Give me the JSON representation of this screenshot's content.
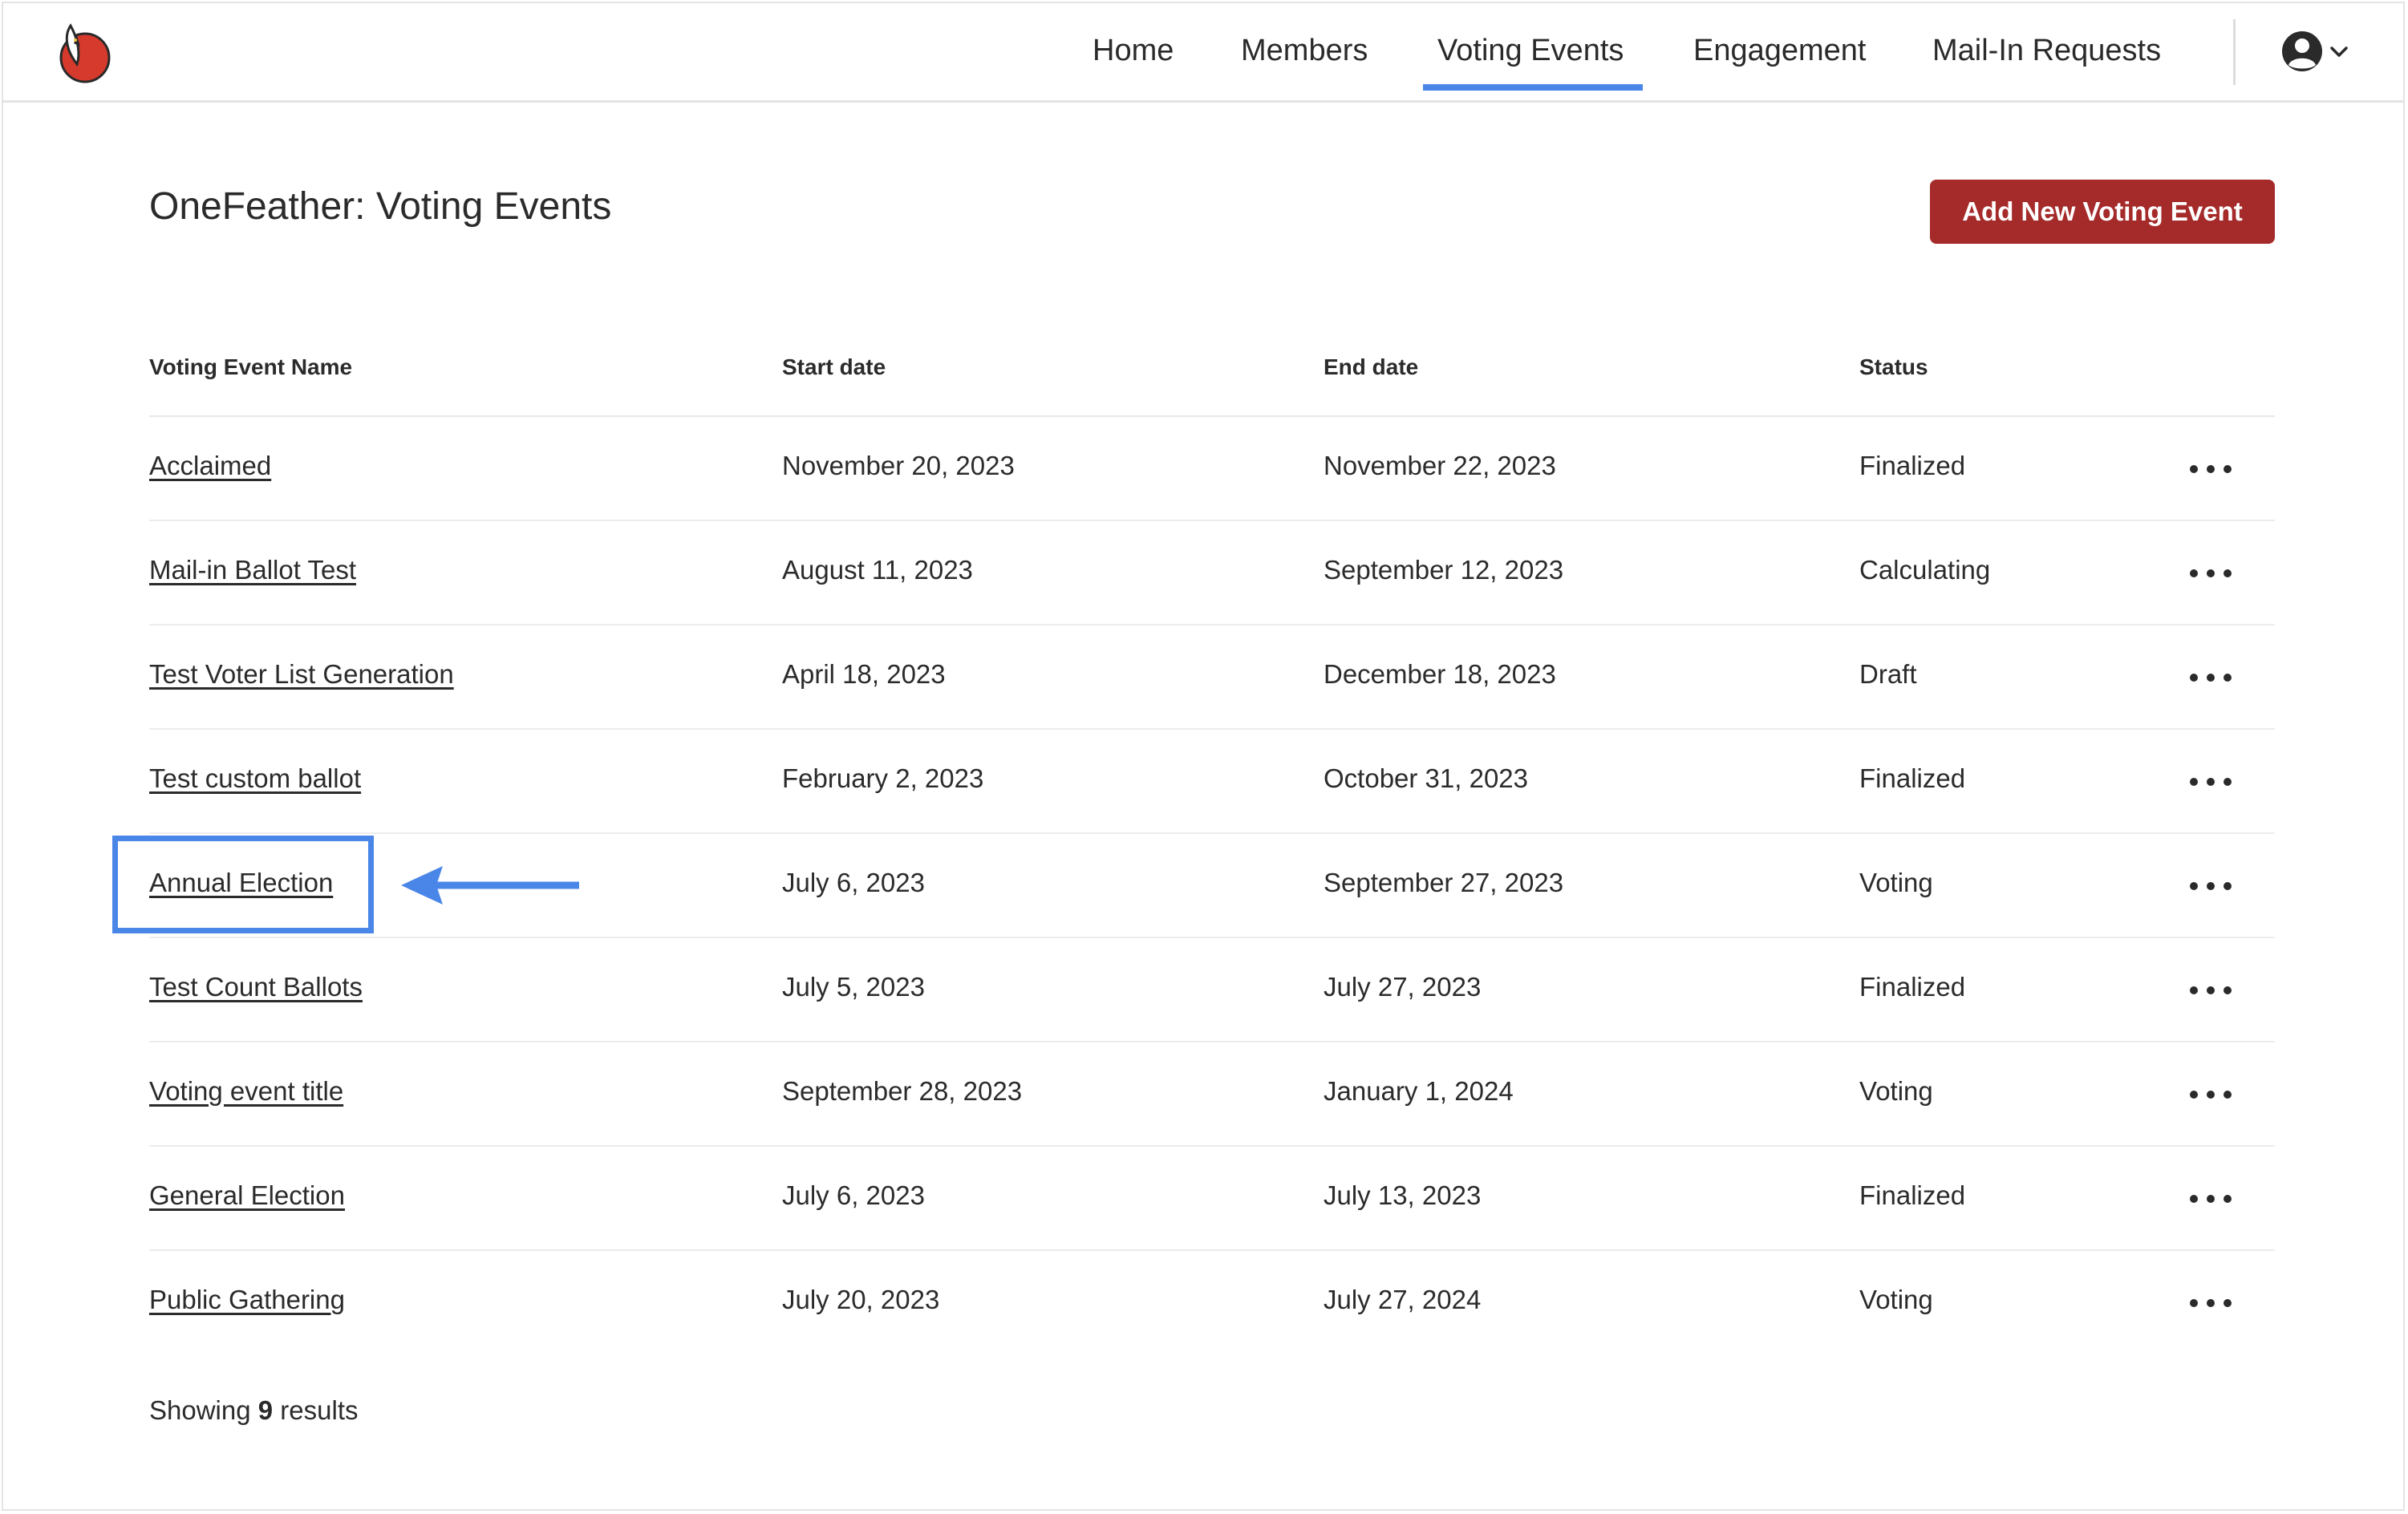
{
  "nav": {
    "logo_icon": "feather-logo-icon",
    "links": [
      {
        "label": "Home",
        "active": false
      },
      {
        "label": "Members",
        "active": false
      },
      {
        "label": "Voting Events",
        "active": true
      },
      {
        "label": "Engagement",
        "active": false
      },
      {
        "label": "Mail-In Requests",
        "active": false
      }
    ],
    "user_icon": "user-circle-icon",
    "chevron_icon": "chevron-down-icon",
    "accent_color": "#4a86e8"
  },
  "header": {
    "title": "OneFeather: Voting Events",
    "add_button_label": "Add New Voting Event",
    "add_button_color": "#a52a2a"
  },
  "table": {
    "columns": [
      "Voting Event Name",
      "Start date",
      "End date",
      "Status"
    ],
    "rows": [
      {
        "name": "Acclaimed",
        "start": "November 20, 2023",
        "end": "November 22, 2023",
        "status": "Finalized"
      },
      {
        "name": "Mail-in Ballot Test",
        "start": "August 11, 2023",
        "end": "September 12, 2023",
        "status": "Calculating"
      },
      {
        "name": "Test Voter List Generation",
        "start": "April 18, 2023",
        "end": "December 18, 2023",
        "status": "Draft"
      },
      {
        "name": "Test custom ballot",
        "start": "February 2, 2023",
        "end": "October 31, 2023",
        "status": "Finalized"
      },
      {
        "name": "Annual Election",
        "start": "July 6, 2023",
        "end": "September 27, 2023",
        "status": "Voting"
      },
      {
        "name": "Test Count Ballots",
        "start": "July 5, 2023",
        "end": "July 27, 2023",
        "status": "Finalized"
      },
      {
        "name": "Voting event title",
        "start": "September 28, 2023",
        "end": "January 1, 2024",
        "status": "Voting"
      },
      {
        "name": "General Election",
        "start": "July 6, 2023",
        "end": "July 13, 2023",
        "status": "Finalized"
      },
      {
        "name": "Public Gathering",
        "start": "July 20, 2023",
        "end": "July 27, 2024",
        "status": "Voting"
      }
    ],
    "row_action_icon": "more-horizontal-icon"
  },
  "footer": {
    "showing_prefix": "Showing",
    "showing_count": "9",
    "showing_suffix": "results"
  },
  "annotation": {
    "highlight_color": "#4a86e8",
    "arrow_icon": "arrow-left-icon"
  }
}
